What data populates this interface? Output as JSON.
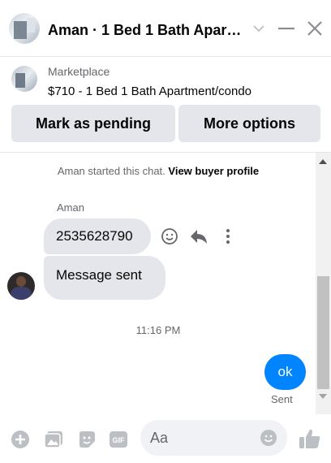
{
  "header": {
    "title": "Aman · 1 Bed 1 Bath Apart..."
  },
  "marketplace": {
    "label": "Marketplace",
    "listing": "$710 - 1 Bed 1 Bath Apartment/condo",
    "pending_button": "Mark as pending",
    "more_button": "More options"
  },
  "chat": {
    "started_text": "Aman started this chat.",
    "buyer_profile_link": "View buyer profile",
    "sender_name": "Aman",
    "messages_in": [
      "2535628790",
      "Message sent"
    ],
    "timestamp": "11:16 PM",
    "message_out": "ok",
    "status": "Sent"
  },
  "composer": {
    "placeholder": "Aa"
  },
  "colors": {
    "accent": "#0084ff",
    "bubble_gray": "#e4e6eb",
    "icon_gray": "#bcc0c4"
  },
  "icons": [
    "chevron-down-icon",
    "minimize-icon",
    "close-icon",
    "emoji-icon",
    "reply-icon",
    "more-icon",
    "plus-icon",
    "photo-icon",
    "sticker-icon",
    "gif-icon",
    "like-icon"
  ]
}
